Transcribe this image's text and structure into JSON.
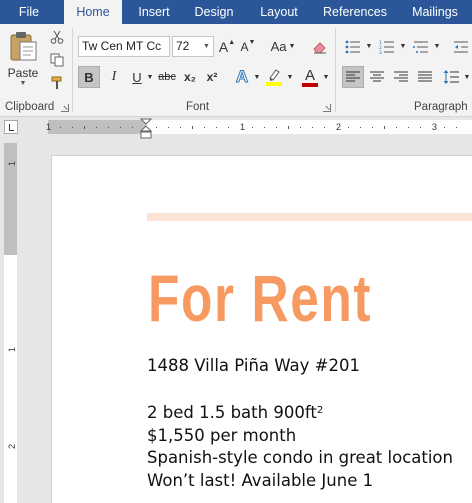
{
  "tabs": [
    "File",
    "Home",
    "Insert",
    "Design",
    "Layout",
    "References",
    "Mailings"
  ],
  "active_tab": "Home",
  "clipboard": {
    "paste_label": "Paste",
    "group_label": "Clipboard"
  },
  "font": {
    "name_value": "Tw Cen MT Cc",
    "size_value": "72",
    "group_label": "Font",
    "bold": "B",
    "italic": "I",
    "underline": "U",
    "strikethrough": "abc",
    "subscript": "x₂",
    "superscript": "x²",
    "grow": "A",
    "shrink": "A",
    "change_case": "Aa",
    "text_effects": "A",
    "font_color": "A"
  },
  "paragraph": {
    "group_label": "Paragraph"
  },
  "ruler": {
    "h_numbers": [
      "1",
      "1",
      "2",
      "3"
    ],
    "v_numbers": [
      "1",
      "1",
      "2"
    ]
  },
  "colors": {
    "accent_title": "#f79a62",
    "bar": "#fbe4d5",
    "ribbon_tab": "#2b579a",
    "highlight": "#ffff00",
    "font_color_bar": "#c00000"
  },
  "document": {
    "title": "For Rent",
    "address": "1488 Villa Piña Way #201",
    "beds_baths": "2 bed 1.5 bath 900ft",
    "beds_baths_sup": "2",
    "price": "$1,550 per month",
    "description": "Spanish-style condo in great location",
    "availability": "Won’t last! Available June 1"
  }
}
